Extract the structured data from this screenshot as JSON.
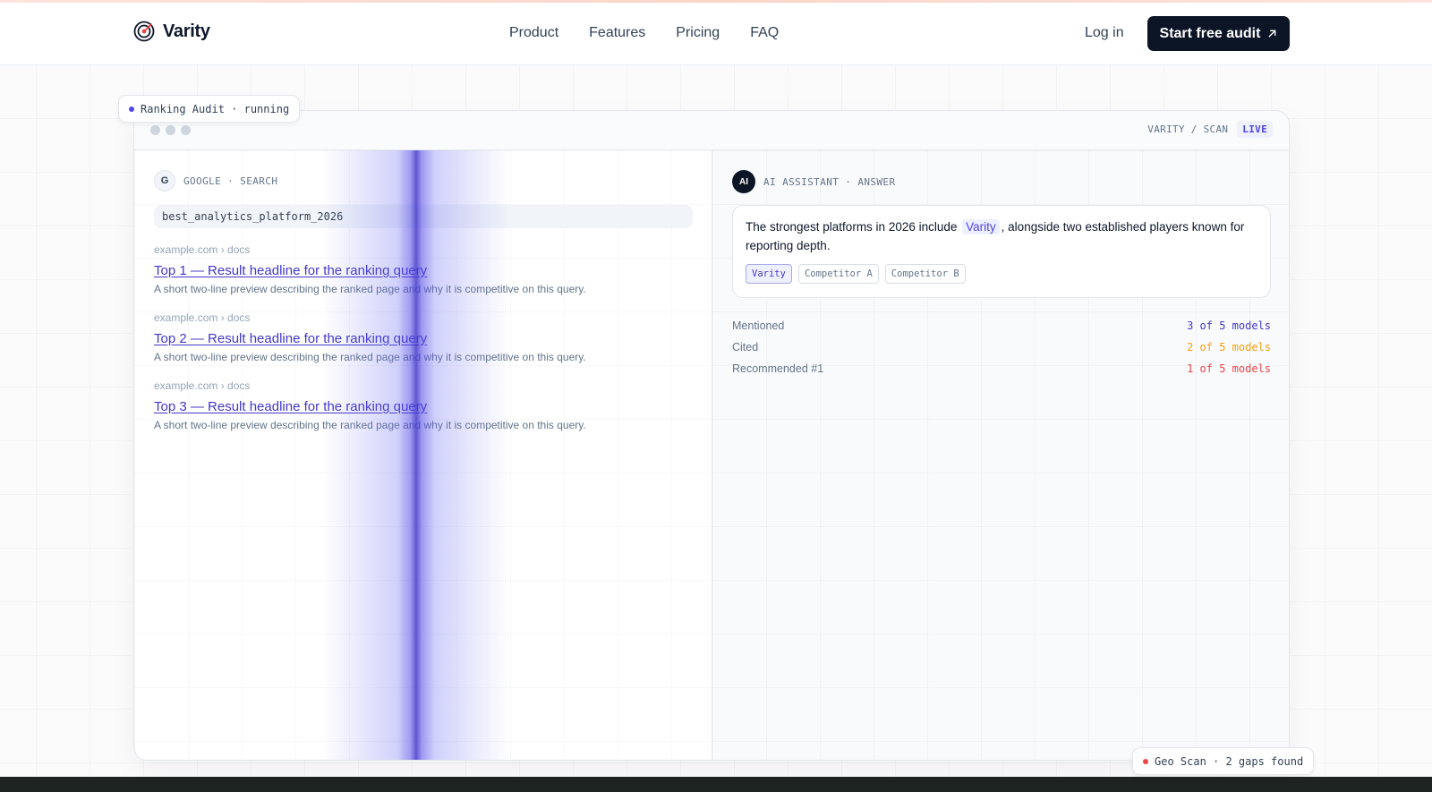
{
  "brand": {
    "name": "Varity",
    "icon": "target-icon"
  },
  "nav": {
    "links": [
      "Product",
      "Features",
      "Pricing",
      "FAQ"
    ],
    "login": "Log in",
    "cta": "Start free audit"
  },
  "badges": {
    "ranking": "Ranking Audit · running",
    "geo": "Geo Scan · 2 gaps found",
    "colors": {
      "ranking_dot": "#4f46e5",
      "geo_dot": "#ef4444"
    }
  },
  "window": {
    "path": "VARITY / SCAN",
    "live": "LIVE"
  },
  "search": {
    "icon_letter": "G",
    "label": "GOOGLE · SEARCH",
    "query": "best_analytics_platform_2026",
    "results": [
      {
        "url": "example.com › docs",
        "title": "Top 1 — Result headline for the ranking query",
        "desc": "A short two-line preview describing the ranked page and why it is competitive on this query."
      },
      {
        "url": "example.com › docs",
        "title": "Top 2 — Result headline for the ranking query",
        "desc": "A short two-line preview describing the ranked page and why it is competitive on this query."
      },
      {
        "url": "example.com › docs",
        "title": "Top 3 — Result headline for the ranking query",
        "desc": "A short two-line preview describing the ranked page and why it is competitive on this query."
      }
    ]
  },
  "assistant": {
    "icon_letter": "AI",
    "label": "AI ASSISTANT · ANSWER",
    "answer_before": "The strongest platforms in 2026 include",
    "answer_highlight": "Varity",
    "answer_after": ", alongside two established players known for reporting depth.",
    "chips": [
      "Varity",
      "Competitor A",
      "Competitor B"
    ],
    "metrics": [
      {
        "label": "Mentioned",
        "value": "3 of 5 models",
        "color": "#4338ca"
      },
      {
        "label": "Cited",
        "value": "2 of 5 models",
        "color": "#f59e0b"
      },
      {
        "label": "Recommended #1",
        "value": "1 of 5 models",
        "color": "#ef4444"
      }
    ]
  }
}
